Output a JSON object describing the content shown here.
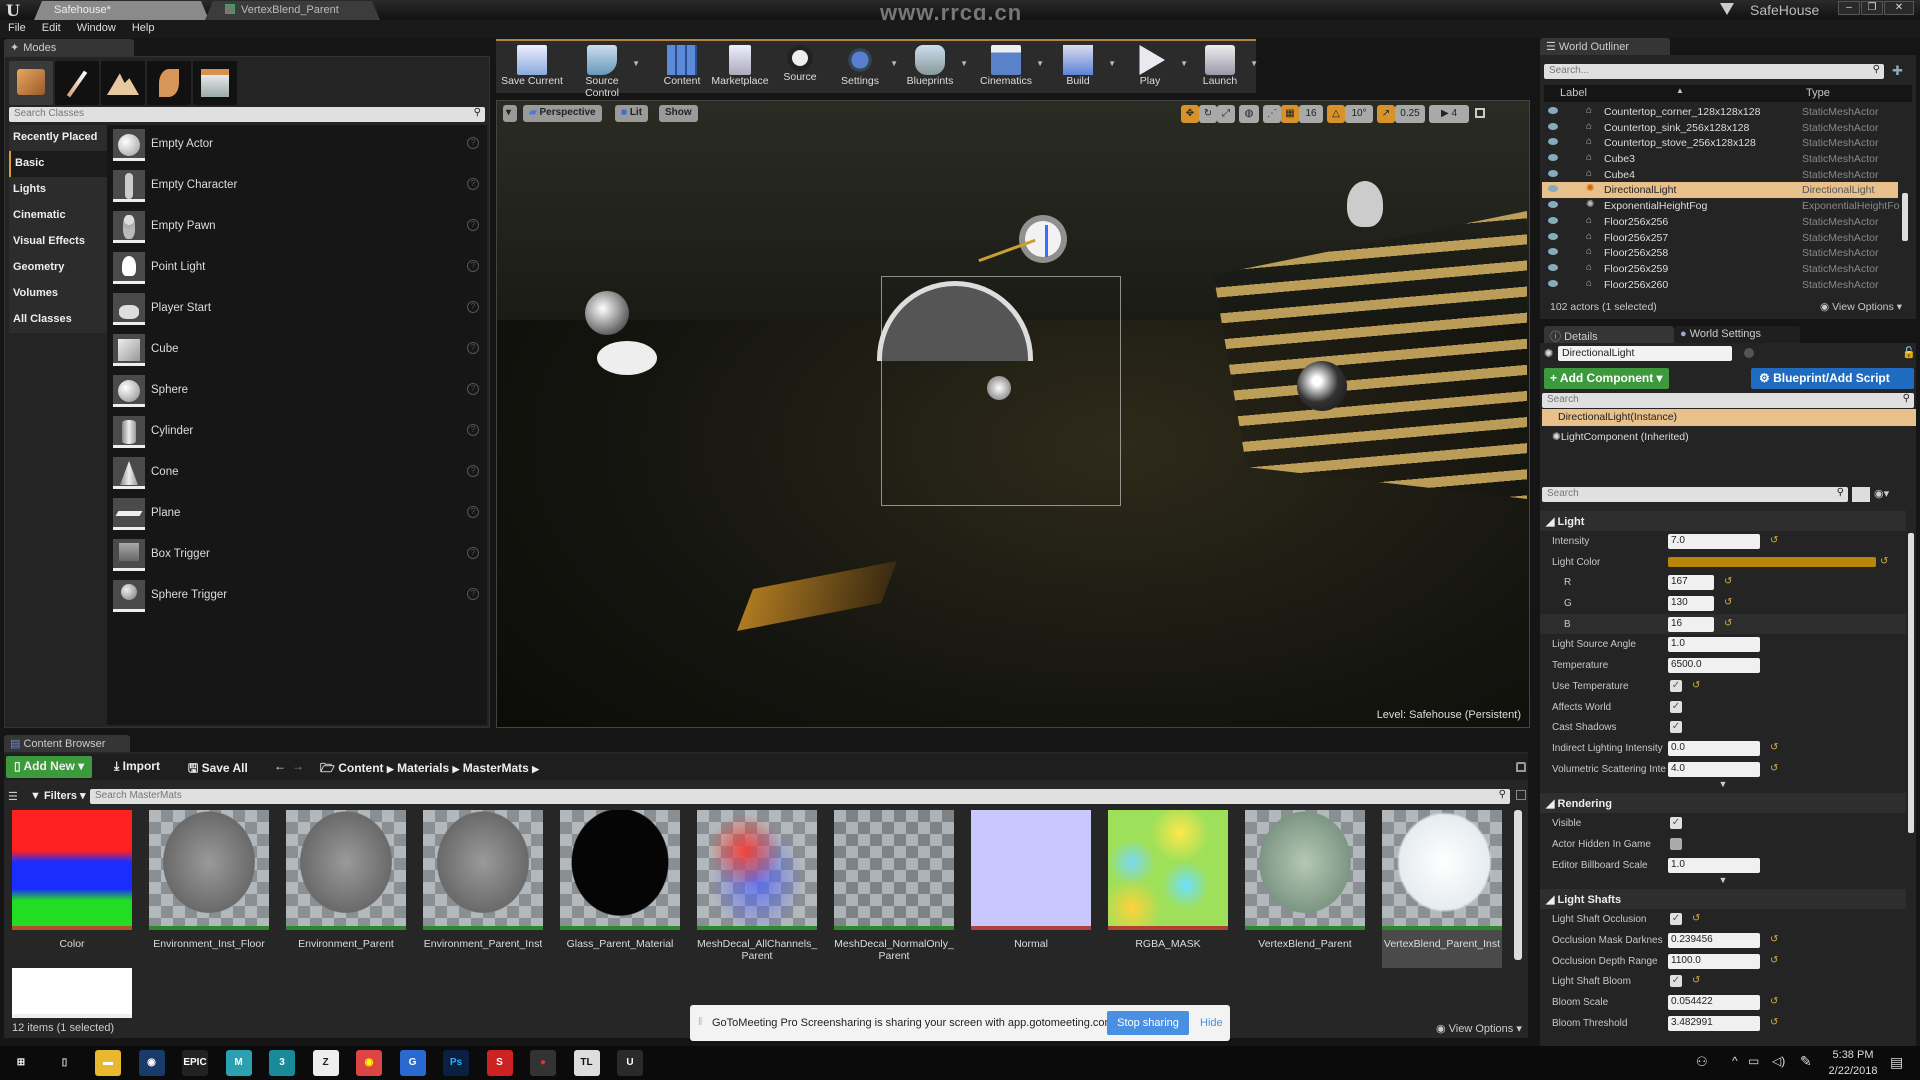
{
  "window": {
    "tabs": [
      {
        "label": "Safehouse*"
      },
      {
        "label": "VertexBlend_Parent"
      }
    ],
    "project_name": "SafeHouse",
    "controls": {
      "minimize": "–",
      "maximize": "❐",
      "close": "✕"
    }
  },
  "menu": [
    "File",
    "Edit",
    "Window",
    "Help"
  ],
  "modes": {
    "tab_label": "Modes",
    "mode_icons": [
      "place-mode-icon",
      "paint-mode-icon",
      "landscape-mode-icon",
      "foliage-mode-icon",
      "geometry-mode-icon"
    ],
    "search_placeholder": "Search Classes",
    "categories": [
      "Recently Placed",
      "Basic",
      "Lights",
      "Cinematic",
      "Visual Effects",
      "Geometry",
      "Volumes",
      "All Classes"
    ],
    "active_category": "Basic",
    "items": [
      "Empty Actor",
      "Empty Character",
      "Empty Pawn",
      "Point Light",
      "Player Start",
      "Cube",
      "Sphere",
      "Cylinder",
      "Cone",
      "Plane",
      "Box Trigger",
      "Sphere Trigger"
    ]
  },
  "toolbar": {
    "buttons": [
      {
        "label": "Save Current",
        "icon": "save-icon"
      },
      {
        "label": "Source Control",
        "icon": "source-control-icon"
      },
      {
        "label": "Content",
        "icon": "content-icon"
      },
      {
        "label": "Marketplace",
        "icon": "marketplace-icon"
      },
      {
        "label": "Source",
        "icon": "source-icon"
      },
      {
        "label": "Settings",
        "icon": "settings-icon"
      },
      {
        "label": "Blueprints",
        "icon": "blueprints-icon"
      },
      {
        "label": "Cinematics",
        "icon": "cinematics-icon"
      },
      {
        "label": "Build",
        "icon": "build-icon"
      },
      {
        "label": "Play",
        "icon": "play-icon"
      },
      {
        "label": "Launch",
        "icon": "launch-icon"
      }
    ]
  },
  "viewport": {
    "view_mode": "Perspective",
    "lighting": "Lit",
    "show": "Show",
    "grid_snap": "16",
    "rotation_snap": "10°",
    "scale_snap": "0.25",
    "camera_speed": "4",
    "level_label": "Level:",
    "level_name": "Safehouse (Persistent)"
  },
  "outliner": {
    "tab_label": "World Outliner",
    "search_placeholder": "Search...",
    "col_label": "Label",
    "col_type": "Type",
    "rows": [
      {
        "label": "Countertop_corner_128x128x128",
        "type": "StaticMeshActor"
      },
      {
        "label": "Countertop_sink_256x128x128",
        "type": "StaticMeshActor"
      },
      {
        "label": "Countertop_stove_256x128x128",
        "type": "StaticMeshActor"
      },
      {
        "label": "Cube3",
        "type": "StaticMeshActor"
      },
      {
        "label": "Cube4",
        "type": "StaticMeshActor"
      },
      {
        "label": "DirectionalLight",
        "type": "DirectionalLight",
        "selected": true
      },
      {
        "label": "ExponentialHeightFog",
        "type": "ExponentialHeightFo"
      },
      {
        "label": "Floor256x256",
        "type": "StaticMeshActor"
      },
      {
        "label": "Floor256x257",
        "type": "StaticMeshActor"
      },
      {
        "label": "Floor256x258",
        "type": "StaticMeshActor"
      },
      {
        "label": "Floor256x259",
        "type": "StaticMeshActor"
      },
      {
        "label": "Floor256x260",
        "type": "StaticMeshActor"
      }
    ],
    "status": "102 actors (1 selected)",
    "view_options": "View Options"
  },
  "details": {
    "tabs": [
      "Details",
      "World Settings"
    ],
    "actor_name": "DirectionalLight",
    "add_component": "+ Add Component",
    "blueprint_button": "Blueprint/Add Script",
    "search_placeholder": "Search",
    "components": [
      "DirectionalLight(Instance)",
      "LightComponent (Inherited)"
    ],
    "sections": {
      "light": {
        "title": "Light",
        "intensity": {
          "label": "Intensity",
          "value": "7.0"
        },
        "light_color": {
          "label": "Light Color",
          "hex": "#b8860b"
        },
        "r": {
          "label": "R",
          "value": "167"
        },
        "g": {
          "label": "G",
          "value": "130"
        },
        "b": {
          "label": "B",
          "value": "16"
        },
        "source_angle": {
          "label": "Light Source Angle",
          "value": "1.0"
        },
        "temperature": {
          "label": "Temperature",
          "value": "6500.0"
        },
        "use_temperature": {
          "label": "Use Temperature",
          "checked": true
        },
        "affects_world": {
          "label": "Affects World",
          "checked": true
        },
        "cast_shadows": {
          "label": "Cast Shadows",
          "checked": true
        },
        "indirect": {
          "label": "Indirect Lighting Intensity",
          "value": "0.0"
        },
        "volumetric": {
          "label": "Volumetric Scattering Inte",
          "value": "4.0"
        }
      },
      "rendering": {
        "title": "Rendering",
        "visible": {
          "label": "Visible",
          "checked": true
        },
        "hidden_in_game": {
          "label": "Actor Hidden In Game",
          "checked": false
        },
        "billboard_scale": {
          "label": "Editor Billboard Scale",
          "value": "1.0"
        }
      },
      "light_shafts": {
        "title": "Light Shafts",
        "occlusion": {
          "label": "Light Shaft Occlusion",
          "checked": true
        },
        "mask_darkness": {
          "label": "Occlusion Mask Darknes",
          "value": "0.239456"
        },
        "depth_range": {
          "label": "Occlusion Depth Range",
          "value": "1100.0"
        },
        "bloom": {
          "label": "Light Shaft Bloom",
          "checked": true
        },
        "bloom_scale": {
          "label": "Bloom Scale",
          "value": "0.054422"
        },
        "bloom_threshold": {
          "label": "Bloom Threshold",
          "value": "3.482991"
        }
      }
    }
  },
  "content_browser": {
    "tab_label": "Content Browser",
    "add_new": "Add New",
    "import": "Import",
    "save_all": "Save All",
    "breadcrumb": [
      "Content",
      "Materials",
      "MasterMats"
    ],
    "filters": "Filters",
    "search_placeholder": "Search MasterMats",
    "assets": [
      {
        "name": "Color",
        "kind": "texture-rgb"
      },
      {
        "name": "Environment_Inst_Floor",
        "kind": "sphere-grey"
      },
      {
        "name": "Environment_Parent",
        "kind": "sphere-grey"
      },
      {
        "name": "Environment_Parent_Inst",
        "kind": "sphere-grey"
      },
      {
        "name": "Glass_Parent_Material",
        "kind": "sphere-black"
      },
      {
        "name": "MeshDecal_AllChannels_ Parent",
        "kind": "decal-color"
      },
      {
        "name": "MeshDecal_NormalOnly_ Parent",
        "kind": "decal-grey"
      },
      {
        "name": "Normal",
        "kind": "texture-normal"
      },
      {
        "name": "RGBA_MASK",
        "kind": "texture-mask"
      },
      {
        "name": "VertexBlend_Parent",
        "kind": "sphere-green"
      },
      {
        "name": "VertexBlend_Parent_Inst",
        "kind": "sphere-white",
        "selected": true
      },
      {
        "name": "",
        "kind": "texture-white"
      }
    ],
    "status": "12 items (1 selected)",
    "view_options": "View Options"
  },
  "notification": {
    "text": "GoToMeeting Pro Screensharing is sharing your screen with app.gotomeeting.com.",
    "stop": "Stop sharing",
    "hide": "Hide"
  },
  "watermark": "www.rrcg.cn",
  "taskbar": {
    "apps": [
      "windows-start",
      "task-view",
      "file-explorer",
      "steam",
      "epic-games",
      "maya",
      "3ds-max",
      "zbrush",
      "chrome",
      "gotomeeting",
      "photoshop",
      "substance",
      "headphones-app",
      "tl-app",
      "unreal-engine"
    ],
    "time": "5:38 PM",
    "date": "2/22/2018"
  }
}
